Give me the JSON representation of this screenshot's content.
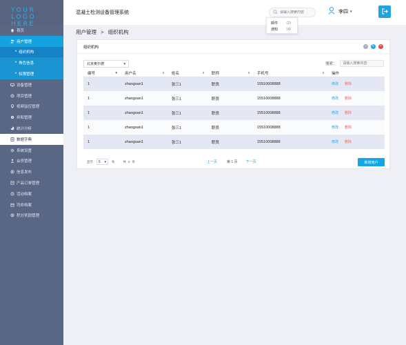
{
  "logo": {
    "line1": "YOUR",
    "line2": "LOGO HERE"
  },
  "sidebar": {
    "items": [
      {
        "label": "首页",
        "icon": "home-icon"
      },
      {
        "label": "用户管理",
        "icon": "users-icon",
        "state": "active-parent"
      },
      {
        "label": "组织机构",
        "state": "sub-selected"
      },
      {
        "label": "角色信息",
        "state": "sub"
      },
      {
        "label": "权限管理",
        "state": "sub"
      },
      {
        "label": "设备管理",
        "icon": "device-icon"
      },
      {
        "label": "项目管理",
        "icon": "project-icon"
      },
      {
        "label": "视频监控管理",
        "icon": "camera-icon"
      },
      {
        "label": "拌和管理",
        "icon": "mixer-icon"
      },
      {
        "label": "统计分析",
        "icon": "chart-icon"
      },
      {
        "label": "数据字典",
        "icon": "dictionary-icon",
        "state": "current"
      },
      {
        "label": "系统设置",
        "icon": "settings-icon"
      },
      {
        "label": "会员管理",
        "icon": "member-icon"
      },
      {
        "label": "信息发布",
        "icon": "publish-icon"
      },
      {
        "label": "产品订单管理",
        "icon": "order-icon"
      },
      {
        "label": "活动档案",
        "icon": "activity-icon"
      },
      {
        "label": "司命档案",
        "icon": "archive-icon"
      },
      {
        "label": "积分奖励管理",
        "icon": "reward-icon"
      }
    ]
  },
  "header": {
    "title": "混凝土检测设备管理系统",
    "search_placeholder": "请输入搜索内容",
    "user_name": "李四",
    "dropdown": [
      {
        "label": "邮件",
        "count": "（2）"
      },
      {
        "label": "通知",
        "count": "（4）"
      }
    ]
  },
  "breadcrumb": {
    "parent": "用户管理",
    "sep": ">",
    "current": "组织机构"
  },
  "panel": {
    "title": "组织机构",
    "org_select": "北京奥尔德",
    "search_label": "搜索：",
    "search_placeholder": "请输入搜索内容",
    "columns": [
      "编号",
      "用户名",
      "姓名",
      "职称",
      "手机号",
      "操作"
    ],
    "rows": [
      {
        "id": "1",
        "username": "zhangsan1",
        "name": "张三1",
        "title": "职员",
        "phone": "15510008888"
      },
      {
        "id": "1",
        "username": "zhangsan1",
        "name": "张三1",
        "title": "职员",
        "phone": "15510008888"
      },
      {
        "id": "1",
        "username": "zhangsan1",
        "name": "张三1",
        "title": "职员",
        "phone": "15510008888"
      },
      {
        "id": "1",
        "username": "zhangsan1",
        "name": "张三1",
        "title": "职员",
        "phone": "15510008888"
      },
      {
        "id": "1",
        "username": "zhangsan1",
        "name": "张三1",
        "title": "职员",
        "phone": "15510008888"
      }
    ],
    "edit_label": "修改",
    "delete_label": "删除",
    "pager": {
      "show_label": "显示",
      "page_size": "5",
      "unit": "条",
      "total_prefix": "共",
      "total": "5",
      "total_suffix": "条",
      "prev": "上一页",
      "page_text": "第 1 页",
      "next": "下一页"
    },
    "add_button": "新增用户"
  },
  "colors": {
    "sidebar_bg": "#5a6784",
    "accent": "#14a3e0",
    "row_stripe": "#e4e8f4",
    "delete": "#ec6b6b"
  }
}
